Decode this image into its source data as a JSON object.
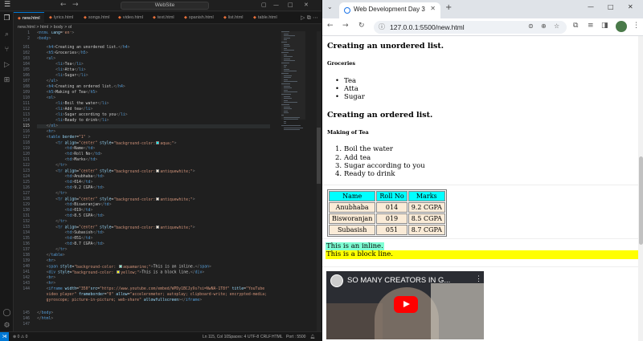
{
  "vscode": {
    "search": "WebSite",
    "tabs": [
      "new.html",
      "lyrics.html",
      "songs.html",
      "video.html",
      "text.html",
      "spanish.html",
      "list.html",
      "table.html"
    ],
    "breadcrumb": "new.html  >  html  >  body  >  ol",
    "line_numbers": [
      "1",
      "2",
      "101",
      "102",
      "103",
      "104",
      "105",
      "106",
      "107",
      "108",
      "109",
      "110",
      "111",
      "112",
      "113",
      "114",
      "115",
      "116",
      "117",
      "118",
      "119",
      "120",
      "121",
      "122",
      "123",
      "124",
      "125",
      "126",
      "127",
      "128",
      "129",
      "130",
      "131",
      "132",
      "133",
      "134",
      "135",
      "136",
      "137",
      "138",
      "139",
      "140",
      "141",
      "142",
      "143",
      "144",
      "",
      "",
      "",
      "145",
      "146",
      "147"
    ],
    "current_line": "115",
    "status": {
      "errors": "0",
      "warnings": "0",
      "position": "Ln 115, Col 10",
      "spaces": "Spaces: 4",
      "encoding": "UTF-8",
      "eol": "CRLF",
      "language": "HTML",
      "port": "Port : 5500"
    }
  },
  "chrome": {
    "tab_title": "Web Development Day 3",
    "url": "127.0.0.1:5500/new.html",
    "page": {
      "h_unordered": "Creating an unordered list.",
      "h_groceries": "Groceries",
      "groceries": [
        "Tea",
        "Atta",
        "Sugar"
      ],
      "h_ordered": "Creating an ordered list.",
      "h_making_tea": "Making of Tea",
      "tea_steps": [
        "Boil the water",
        "Add tea",
        "Sugar according to you",
        "Ready to drink"
      ],
      "table": {
        "headers": [
          "Name",
          "Roll No",
          "Marks"
        ],
        "rows": [
          [
            "Anubhaba",
            "014",
            "9.2 CGPA"
          ],
          [
            "Bisworanjan",
            "019",
            "8.5 CGPA"
          ],
          [
            "Subasish",
            "051",
            "8.7 CGPA"
          ]
        ]
      },
      "inline_text": "This is an inline.",
      "block_text": "This is a block line.",
      "video_title": "SO MANY CREATORS IN G..."
    }
  },
  "colors": {
    "aqua": "#00ffff",
    "antiquewhite": "#faebd7",
    "aquamarine": "#7fffd4",
    "yellow": "#ffff00",
    "vscode_accent": "#0078d4",
    "youtube_red": "#ff0000"
  },
  "icons": [
    "menu-icon",
    "back-icon",
    "forward-icon",
    "reload-icon",
    "info-icon",
    "bookmark-star-icon",
    "zoom-icon",
    "translate-icon",
    "extensions-icon",
    "sidebar-icon",
    "kebab-icon",
    "explorer-icon",
    "search-icon",
    "source-control-icon",
    "run-debug-icon",
    "extensions-activity-icon",
    "account-icon",
    "settings-gear-icon",
    "play-icon"
  ]
}
